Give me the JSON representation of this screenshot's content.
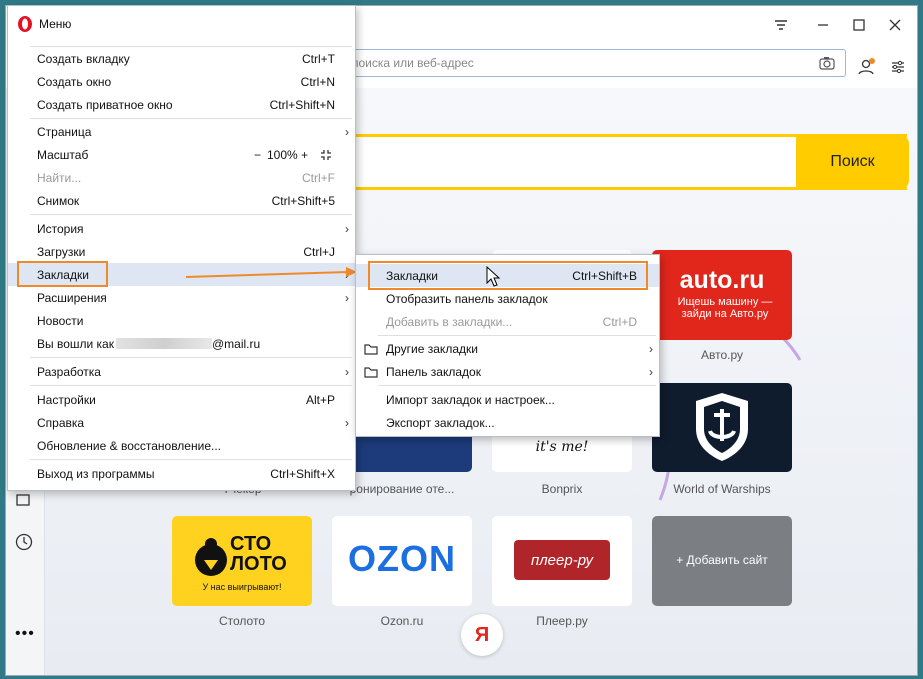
{
  "menu": {
    "title": "Меню",
    "items": [
      {
        "label": "Создать вкладку",
        "shortcut": "Ctrl+T"
      },
      {
        "label": "Создать окно",
        "shortcut": "Ctrl+N"
      },
      {
        "label": "Создать приватное окно",
        "shortcut": "Ctrl+Shift+N"
      },
      {
        "label": "Страница",
        "shortcut": ""
      },
      {
        "label": "Масштаб",
        "shortcut": ""
      },
      {
        "label": "Найти...",
        "shortcut": "Ctrl+F"
      },
      {
        "label": "Снимок",
        "shortcut": "Ctrl+Shift+5"
      },
      {
        "label": "История",
        "shortcut": ""
      },
      {
        "label": "Загрузки",
        "shortcut": "Ctrl+J"
      },
      {
        "label": "Закладки",
        "shortcut": ""
      },
      {
        "label": "Расширения",
        "shortcut": ""
      },
      {
        "label": "Новости",
        "shortcut": ""
      },
      {
        "label": "Вы вошли как",
        "shortcut": ""
      },
      {
        "label": "Разработка",
        "shortcut": ""
      },
      {
        "label": "Настройки",
        "shortcut": "Alt+P"
      },
      {
        "label": "Справка",
        "shortcut": ""
      },
      {
        "label": "Обновление & восстановление...",
        "shortcut": ""
      },
      {
        "label": "Выход из программы",
        "shortcut": "Ctrl+Shift+X"
      }
    ],
    "zoom": {
      "minus": "−",
      "value": "100%",
      "plus": "+"
    },
    "account_suffix": "@mail.ru"
  },
  "submenu": {
    "items": [
      {
        "label": "Закладки",
        "shortcut": "Ctrl+Shift+B"
      },
      {
        "label": "Отобразить панель закладок",
        "shortcut": ""
      },
      {
        "label": "Добавить в закладки...",
        "shortcut": "Ctrl+D"
      },
      {
        "label": "Другие закладки",
        "shortcut": ""
      },
      {
        "label": "Панель закладок",
        "shortcut": ""
      },
      {
        "label": "Импорт закладок и настроек...",
        "shortcut": ""
      },
      {
        "label": "Экспорт закладок...",
        "shortcut": ""
      }
    ]
  },
  "address_bar": {
    "placeholder": "поиска или веб-адрес"
  },
  "search": {
    "button": "Поиск"
  },
  "speed_dial": {
    "auto_logo": "auto.ru",
    "auto_sub": "Ищешь машину — зайди на Авто.ру",
    "auto_caption": "Авто.ру",
    "wows_caption": "World of Warships",
    "bonprix_text": "it's me!",
    "bonprix_caption": "Bonprix",
    "booking_caption": "ронирование оте...",
    "travel_caption": "Тчекер",
    "stoloto_logo_1": "СТО",
    "stoloto_logo_2": "ЛОТО",
    "stoloto_sub": "У нас выигрывают!",
    "stoloto_caption": "Столото",
    "ozon_logo": "OZON",
    "ozon_caption": "Ozon.ru",
    "pleer_logo": "плеер-ру",
    "pleer_caption": "Плеер.ру",
    "add_site": "+ Добавить сайт",
    "yandex_letter": "Я"
  },
  "colors": {
    "accent": "#ffcc00",
    "highlight": "#f0892a",
    "opera_red": "#e81123"
  }
}
